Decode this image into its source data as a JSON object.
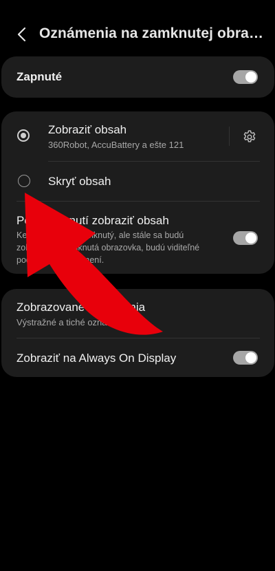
{
  "header": {
    "title": "Oznámenia na zamknutej obrazovke"
  },
  "master": {
    "label": "Zapnuté",
    "on": true
  },
  "content_options": {
    "show": {
      "label": "Zobraziť obsah",
      "sub": "360Robot, AccuBattery a ešte 121",
      "selected": true
    },
    "hide": {
      "label": "Skryť obsah",
      "selected": false
    },
    "show_when_unlocked": {
      "label": "Po odomknutí zobraziť obsah",
      "desc": "Keď je telefón odomknutý, ale stále sa budú zobrazovať zamknutá obrazovka, budú viditeľné podrobnosti oznámení.",
      "on": true
    }
  },
  "display": {
    "shown_notifications": {
      "label": "Zobrazované oznámenia",
      "sub": "Výstražné a tiché oznámenia"
    },
    "aod": {
      "label": "Zobraziť na Always On Display",
      "on": true
    }
  },
  "colors": {
    "background": "#000000",
    "card": "#1d1d1d",
    "toggle_on": "#a6a6a6",
    "annotation_arrow": "#e8000b"
  },
  "icons": {
    "back": "chevron-left-icon",
    "settings": "gear-icon",
    "annotation": "curved-arrow-icon"
  }
}
